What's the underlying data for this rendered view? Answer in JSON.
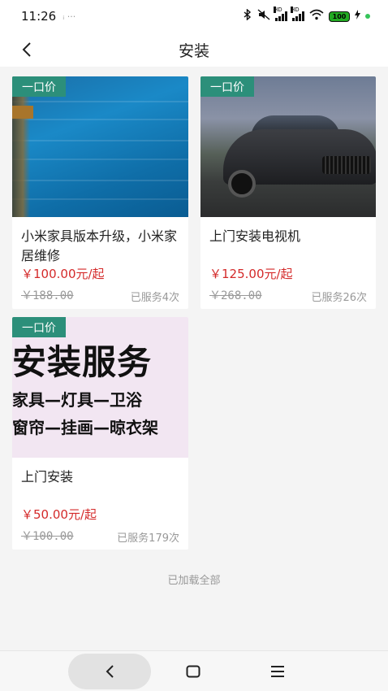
{
  "status": {
    "time": "11:26",
    "extra": "ᵢ ···",
    "hd1": "HD",
    "hd2": "HD",
    "battery": "100"
  },
  "header": {
    "title": "安装"
  },
  "cards": [
    {
      "badge": "一口价",
      "name": "小米家具版本升级，小米家居维修",
      "price": "￥100.00元/起",
      "original": "￥188.00",
      "served": "已服务4次"
    },
    {
      "badge": "一口价",
      "name": "上门安装电视机",
      "price": "￥125.00元/起",
      "original": "￥268.00",
      "served": "已服务26次"
    },
    {
      "badge": "一口价",
      "name": "上门安装",
      "price": "￥50.00元/起",
      "original": "￥100.00",
      "served": "已服务179次",
      "banner": {
        "big": "安装服务",
        "line1": "家具—灯具—卫浴",
        "line2": "窗帘—挂画—晾衣架"
      }
    }
  ],
  "footer": {
    "load_all": "已加载全部"
  },
  "colors": {
    "badge": "#2c8f7a",
    "price": "#d42a2a",
    "muted": "#999999",
    "background": "#f4f4f4"
  },
  "icons": {
    "back": "chevron-left-icon",
    "nav_back": "nav-back-icon",
    "nav_home": "nav-home-icon",
    "nav_menu": "nav-menu-icon"
  }
}
